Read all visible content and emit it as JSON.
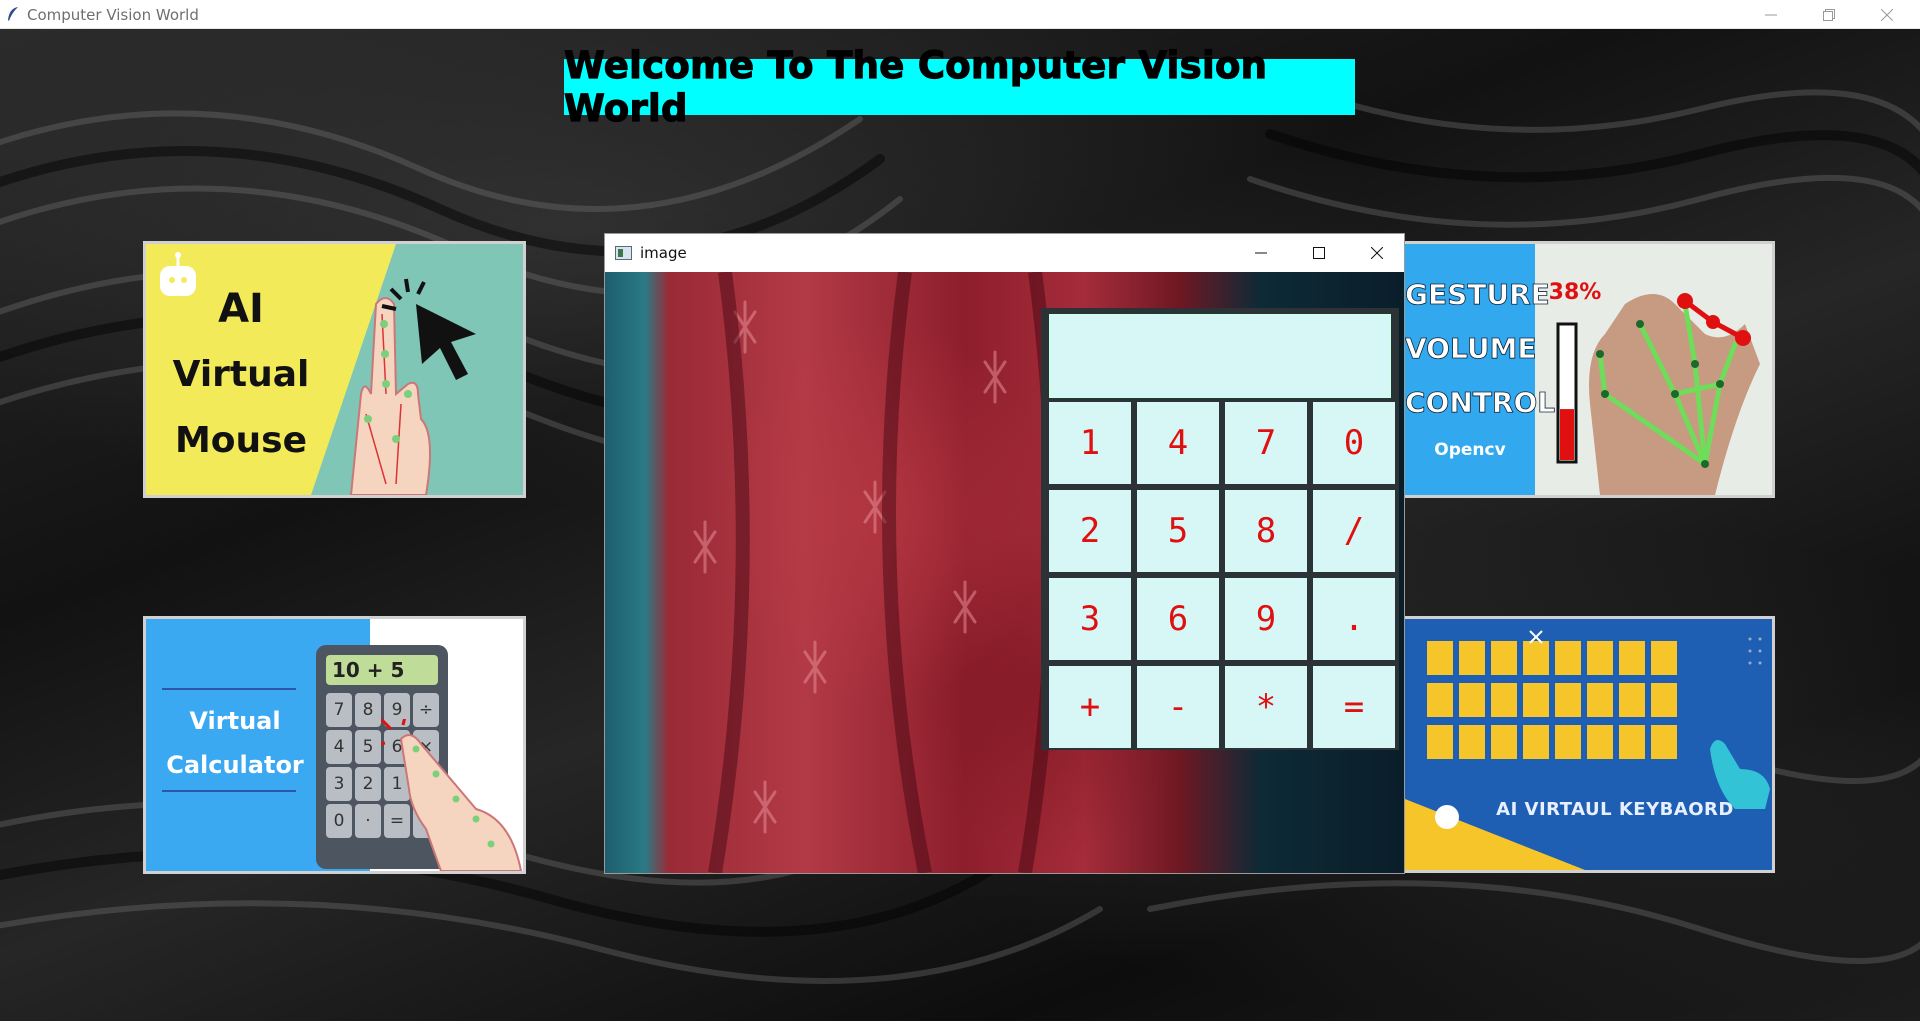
{
  "window": {
    "title": "Computer Vision World",
    "icon": "feather-icon"
  },
  "banner": {
    "text": "Welcome To The Computer Vision World",
    "bg_color": "#00ffff"
  },
  "tiles": {
    "mouse": {
      "line1": "AI",
      "line2": "Virtual",
      "line3": "Mouse"
    },
    "calculator": {
      "line1": "Virtual",
      "line2": "Calculator",
      "screen": "10 + 5",
      "keys": [
        "7",
        "8",
        "9",
        "÷",
        "4",
        "5",
        "6",
        "×",
        "3",
        "2",
        "1",
        "−",
        "0",
        "·",
        "=",
        "+"
      ]
    },
    "volume": {
      "line1": "GESTURE",
      "line2": "VOLUME",
      "line3": "CONTROL",
      "line4": "Opencv",
      "percent": "38%",
      "level": 0.38
    },
    "keyboard": {
      "caption": "AI VIRTAUL KEYBAORD"
    }
  },
  "image_window": {
    "title": "image",
    "calculator": {
      "display": "",
      "keys": [
        [
          "1",
          "4",
          "7",
          "0"
        ],
        [
          "2",
          "5",
          "8",
          "/"
        ],
        [
          "3",
          "6",
          "9",
          "."
        ],
        [
          "+",
          "-",
          "*",
          "="
        ]
      ]
    }
  },
  "colors": {
    "calc_key_bg": "#d7f7f7",
    "calc_key_text": "#e01010",
    "calc_frame": "#2b3336"
  }
}
